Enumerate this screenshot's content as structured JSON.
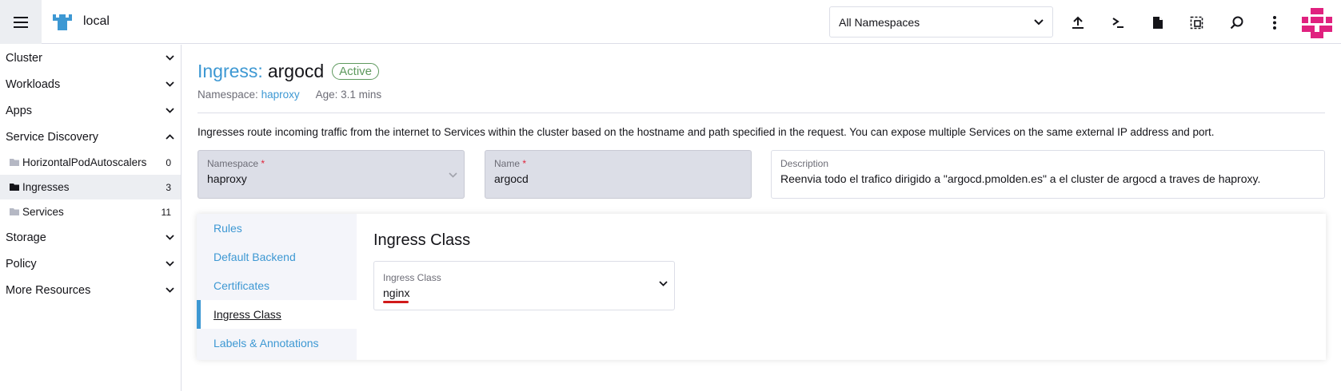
{
  "header": {
    "cluster_name": "local",
    "namespace_select": "All Namespaces",
    "icons": [
      "menu-icon",
      "upload-icon",
      "terminal-icon",
      "file-icon",
      "copy-config-icon",
      "search-icon",
      "more-vertical-icon"
    ]
  },
  "sidebar": {
    "groups": [
      {
        "label": "Cluster"
      },
      {
        "label": "Workloads"
      },
      {
        "label": "Apps"
      },
      {
        "label": "Service Discovery"
      },
      {
        "label": "Storage"
      },
      {
        "label": "Policy"
      },
      {
        "label": "More Resources"
      }
    ],
    "service_discovery_items": [
      {
        "label": "HorizontalPodAutoscalers",
        "count": "0"
      },
      {
        "label": "Ingresses",
        "count": "3"
      },
      {
        "label": "Services",
        "count": "11"
      }
    ]
  },
  "resource": {
    "kind": "Ingress:",
    "name": "argocd",
    "status": "Active",
    "namespace_label": "Namespace:",
    "namespace_value": "haproxy",
    "age": "Age: 3.1 mins",
    "description_text": "Ingresses route incoming traffic from the internet to Services within the cluster based on the hostname and path specified in the request. You can expose multiple Services on the same external IP address and port."
  },
  "form": {
    "namespace_label": "Namespace",
    "namespace_value": "haproxy",
    "name_label": "Name",
    "name_value": "argocd",
    "desc_label": "Description",
    "desc_value": "Reenvia todo el trafico dirigido a \"argocd.pmolden.es\" a el cluster de argocd a traves de haproxy.",
    "required_mark": "*"
  },
  "tabs": [
    {
      "label": "Rules"
    },
    {
      "label": "Default Backend"
    },
    {
      "label": "Certificates"
    },
    {
      "label": "Ingress Class"
    },
    {
      "label": "Labels & Annotations"
    }
  ],
  "ingress_class": {
    "section_title": "Ingress Class",
    "field_label": "Ingress Class",
    "value": "nginx"
  },
  "colors": {
    "link": "#3d98d3",
    "active_status": "#5d995d",
    "required": "#e0243b",
    "avatar": "#e0217f"
  }
}
